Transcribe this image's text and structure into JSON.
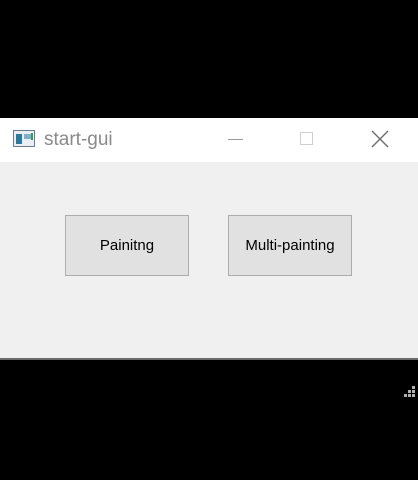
{
  "window": {
    "title": "start-gui",
    "controls": {
      "minimize_icon": "minimize-icon",
      "maximize_icon": "maximize-icon",
      "close_icon": "close-icon"
    }
  },
  "buttons": {
    "painting_label": "Painitng",
    "multi_painting_label": "Multi-painting"
  },
  "colors": {
    "client_background": "#f0f0f0",
    "button_face": "#e1e1e1",
    "button_border": "#adadad",
    "titlebar_background": "#ffffff",
    "outer_background": "#000000"
  }
}
